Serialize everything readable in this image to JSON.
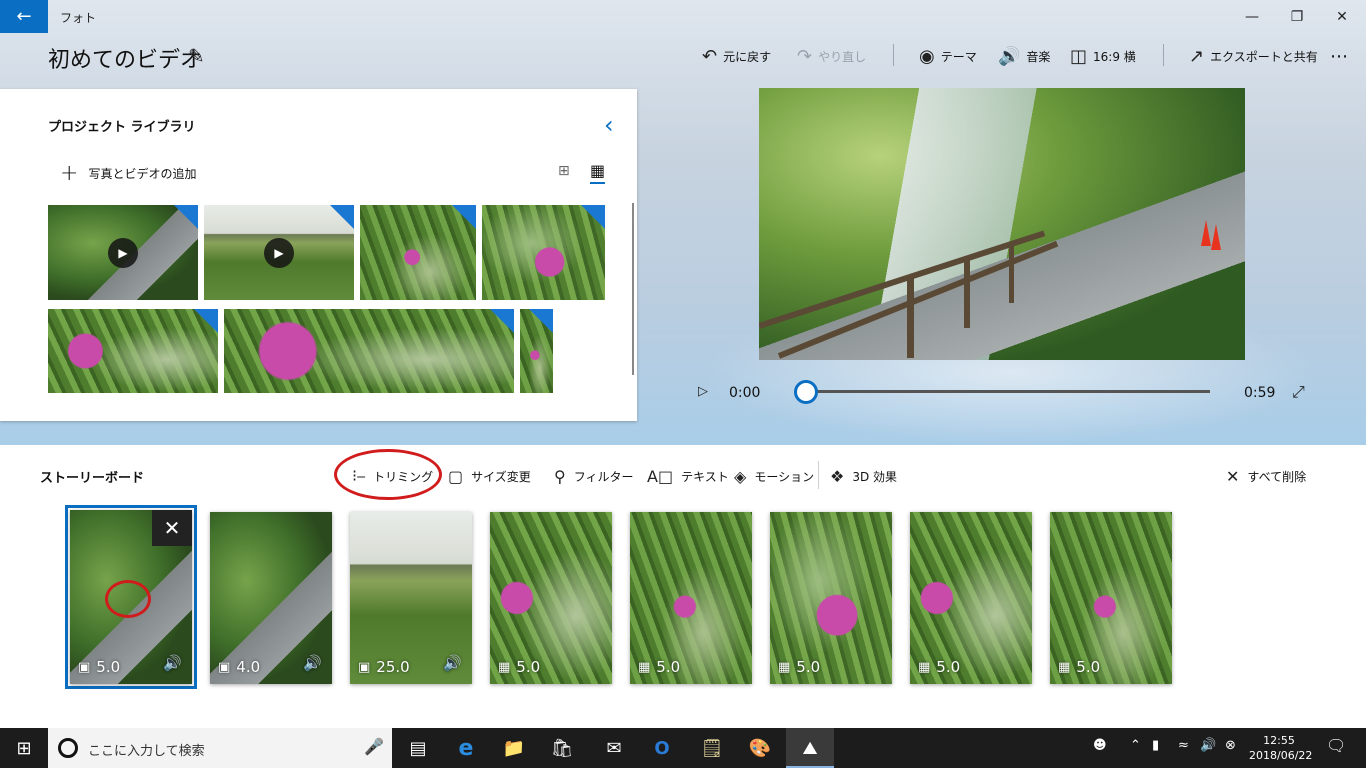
{
  "window": {
    "app_title": "フォト",
    "back_icon": "back-arrow-icon",
    "minimize_icon": "minimize-icon",
    "maximize_icon": "restore-icon",
    "close_icon": "close-icon"
  },
  "header": {
    "project_title": "初めてのビデオ",
    "edit_icon": "pencil-icon",
    "commands": [
      {
        "label": "元に戻す",
        "icon": "undo-icon",
        "enabled": true
      },
      {
        "label": "やり直し",
        "icon": "redo-icon",
        "enabled": false
      },
      {
        "label": "テーマ",
        "icon": "palette-icon",
        "enabled": true
      },
      {
        "label": "音楽",
        "icon": "speaker-icon",
        "enabled": true
      },
      {
        "label": "16:9 横",
        "icon": "aspect-ratio-icon",
        "enabled": true
      },
      {
        "label": "エクスポートと共有",
        "icon": "share-icon",
        "enabled": true
      }
    ],
    "more_icon": "more-icon"
  },
  "library": {
    "title": "プロジェクト ライブラリ",
    "add_label": "写真とビデオの追加",
    "items": [
      {
        "type": "video",
        "scene": "road"
      },
      {
        "type": "video",
        "scene": "field"
      },
      {
        "type": "photo",
        "scene": "flower"
      },
      {
        "type": "photo",
        "scene": "flower3"
      },
      {
        "type": "photo",
        "scene": "flower2"
      },
      {
        "type": "photo",
        "scene": "flower2"
      },
      {
        "type": "photo",
        "scene": "flower"
      }
    ]
  },
  "player": {
    "current_time": "0:00",
    "total_time": "0:59",
    "progress": 0
  },
  "storyboard": {
    "title": "ストーリーボード",
    "tools": [
      {
        "label": "トリミング",
        "icon": "trim-icon"
      },
      {
        "label": "サイズ変更",
        "icon": "resize-icon"
      },
      {
        "label": "フィルター",
        "icon": "filter-icon"
      },
      {
        "label": "テキスト",
        "icon": "text-icon"
      },
      {
        "label": "モーション",
        "icon": "motion-icon"
      },
      {
        "label": "3D 効果",
        "icon": "3d-effects-icon"
      }
    ],
    "remove_all": "すべて削除",
    "clips": [
      {
        "type": "video",
        "duration": "5.0",
        "audio": true,
        "scene": "road",
        "selected": true
      },
      {
        "type": "video",
        "duration": "4.0",
        "audio": true,
        "scene": "road"
      },
      {
        "type": "video",
        "duration": "25.0",
        "audio": true,
        "scene": "field"
      },
      {
        "type": "photo",
        "duration": "5.0",
        "audio": false,
        "scene": "flower2"
      },
      {
        "type": "photo",
        "duration": "5.0",
        "audio": false,
        "scene": "flower"
      },
      {
        "type": "photo",
        "duration": "5.0",
        "audio": false,
        "scene": "flower3"
      },
      {
        "type": "photo",
        "duration": "5.0",
        "audio": false,
        "scene": "flower2"
      },
      {
        "type": "photo",
        "duration": "5.0",
        "audio": false,
        "scene": "flower"
      }
    ]
  },
  "taskbar": {
    "search_placeholder": "ここに入力して検索",
    "time": "12:55",
    "date": "2018/06/22"
  },
  "colors": {
    "accent": "#0a6fc2",
    "annotation_red": "#d01c1c"
  }
}
